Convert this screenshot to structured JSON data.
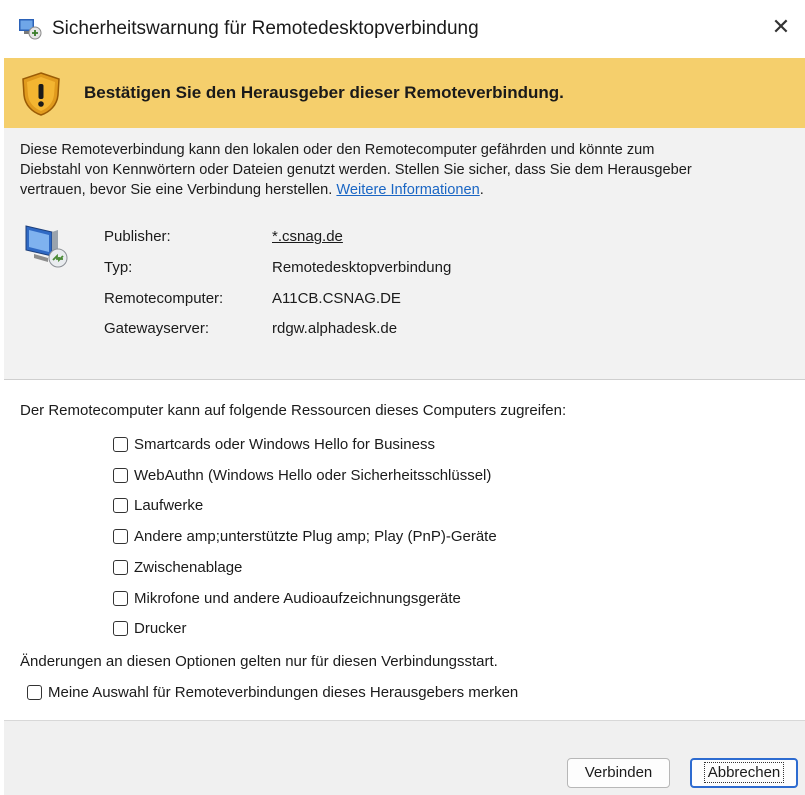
{
  "window": {
    "title": "Sicherheitswarnung für Remotedesktopverbindung",
    "close_glyph": "✕"
  },
  "banner": {
    "text": "Bestätigen Sie den Herausgeber dieser Remoteverbindung."
  },
  "description": {
    "line1": "Diese Remoteverbindung kann den lokalen oder den Remotecomputer gefährden und könnte zum",
    "line2": "Diebstahl von Kennwörtern oder Dateien genutzt werden. Stellen Sie sicher, dass Sie dem Herausgeber",
    "line3": "vertrauen, bevor Sie eine Verbindung herstellen.",
    "link": "Weitere Informationen",
    "after_link": "."
  },
  "info": [
    {
      "label": "Publisher:",
      "value": "*.csnag.de",
      "is_link": true
    },
    {
      "label": "Typ:",
      "value": "Remotedesktopverbindung",
      "is_link": false
    },
    {
      "label": "Remotecomputer:",
      "value": "A11CB.CSNAG.DE",
      "is_link": false
    },
    {
      "label": "Gatewayserver:",
      "value": "rdgw.alphadesk.de",
      "is_link": false
    }
  ],
  "resources": {
    "heading": "Der Remotecomputer kann auf folgende Ressourcen dieses Computers zugreifen:",
    "items": [
      {
        "label": "Smartcards oder Windows Hello for Business",
        "checked": false
      },
      {
        "label": "WebAuthn (Windows Hello oder Sicherheitsschlüssel)",
        "checked": false
      },
      {
        "label": "Laufwerke",
        "checked": false
      },
      {
        "label": "Andere amp;unterstützte Plug amp; Play (PnP)-Geräte",
        "checked": false
      },
      {
        "label": "Zwischenablage",
        "checked": false
      },
      {
        "label": "Mikrofone und andere Audioaufzeichnungsgeräte",
        "checked": false
      },
      {
        "label": "Drucker",
        "checked": false
      }
    ]
  },
  "note": "Änderungen an diesen Optionen gelten nur für diesen Verbindungsstart.",
  "remember": {
    "label": "Meine Auswahl für Remoteverbindungen dieses Herausgebers merken",
    "checked": false
  },
  "buttons": {
    "connect": "Verbinden",
    "cancel": "Abbrechen"
  },
  "colors": {
    "banner": "#f5cf6c",
    "link": "#1a66c4",
    "focus": "#2d6bd0"
  }
}
